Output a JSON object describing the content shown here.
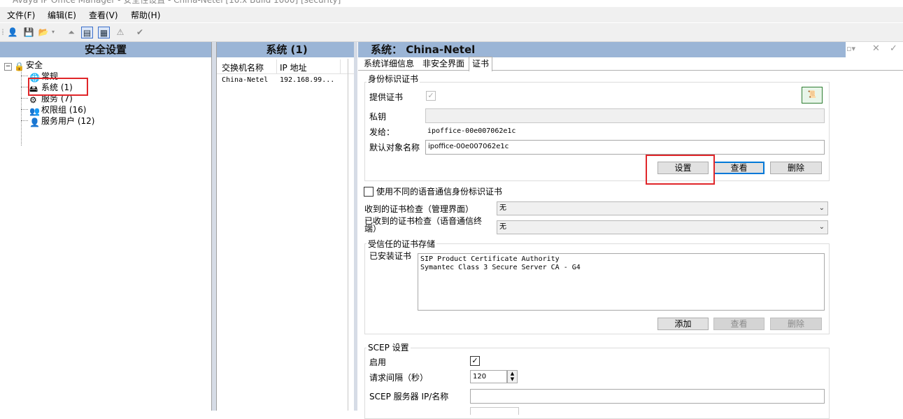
{
  "window": {
    "title": "Avaya IP Office Manager - 安全性设置 - China-Netel [10.x Build 1000] [security]"
  },
  "menu": [
    "文件(F)",
    "编辑(E)",
    "查看(V)",
    "帮助(H)"
  ],
  "left_panel": {
    "title": "安全设置",
    "tree": {
      "root": "安全",
      "items": [
        "常规",
        "系统 (1)",
        "服务 (7)",
        "权限组 (16)",
        "服务用户 (12)"
      ]
    }
  },
  "middle_panel": {
    "title": "系统 (1)",
    "columns": [
      "交换机名称",
      "IP 地址"
    ],
    "rows": [
      [
        "China-Netel",
        "192.168.99..."
      ]
    ]
  },
  "right_panel": {
    "title": "系统： China-Netel",
    "tabs": [
      "系统详细信息",
      "非安全界面",
      "证书"
    ],
    "selected_tab": 2,
    "identity_cert": {
      "group_title": "身份标识证书",
      "offer_cert_label": "提供证书",
      "offer_cert_checked": true,
      "private_key_label": "私钥",
      "private_key_value": "",
      "issued_to_label": "发给：",
      "issued_to_value": "ipoffice-00e007062e1c",
      "default_name_label": "默认对象名称",
      "default_name_value": "ipoffice-00e007062e1c",
      "buttons": {
        "set": "设置",
        "view": "查看",
        "delete": "删除"
      }
    },
    "different_voice_cert_label": "使用不同的语音通信身份标识证书",
    "different_voice_cert_checked": false,
    "received_check_mgmt_label": "收到的证书检查（管理界面）",
    "received_check_mgmt_value": "无",
    "received_check_voice_label": "已收到的证书检查（语音通信终端）",
    "received_check_voice_value": "无",
    "trusted_store": {
      "group_title": "受信任的证书存储",
      "installed_label": "已安装证书",
      "certificates": [
        "SIP Product Certificate Authority",
        "Symantec Class 3 Secure Server CA - G4"
      ],
      "buttons": {
        "add": "添加",
        "view": "查看",
        "delete": "删除"
      }
    },
    "scep": {
      "group_title": "SCEP 设置",
      "enable_label": "启用",
      "enable_checked": true,
      "interval_label": "请求间隔（秒）",
      "interval_value": "120",
      "server_label": "SCEP 服务器 IP/名称",
      "server_value": ""
    }
  },
  "colors": {
    "panel_header": "#9bb5d6",
    "highlight_box": "#e0262a",
    "focus_button": "#0078d7"
  }
}
